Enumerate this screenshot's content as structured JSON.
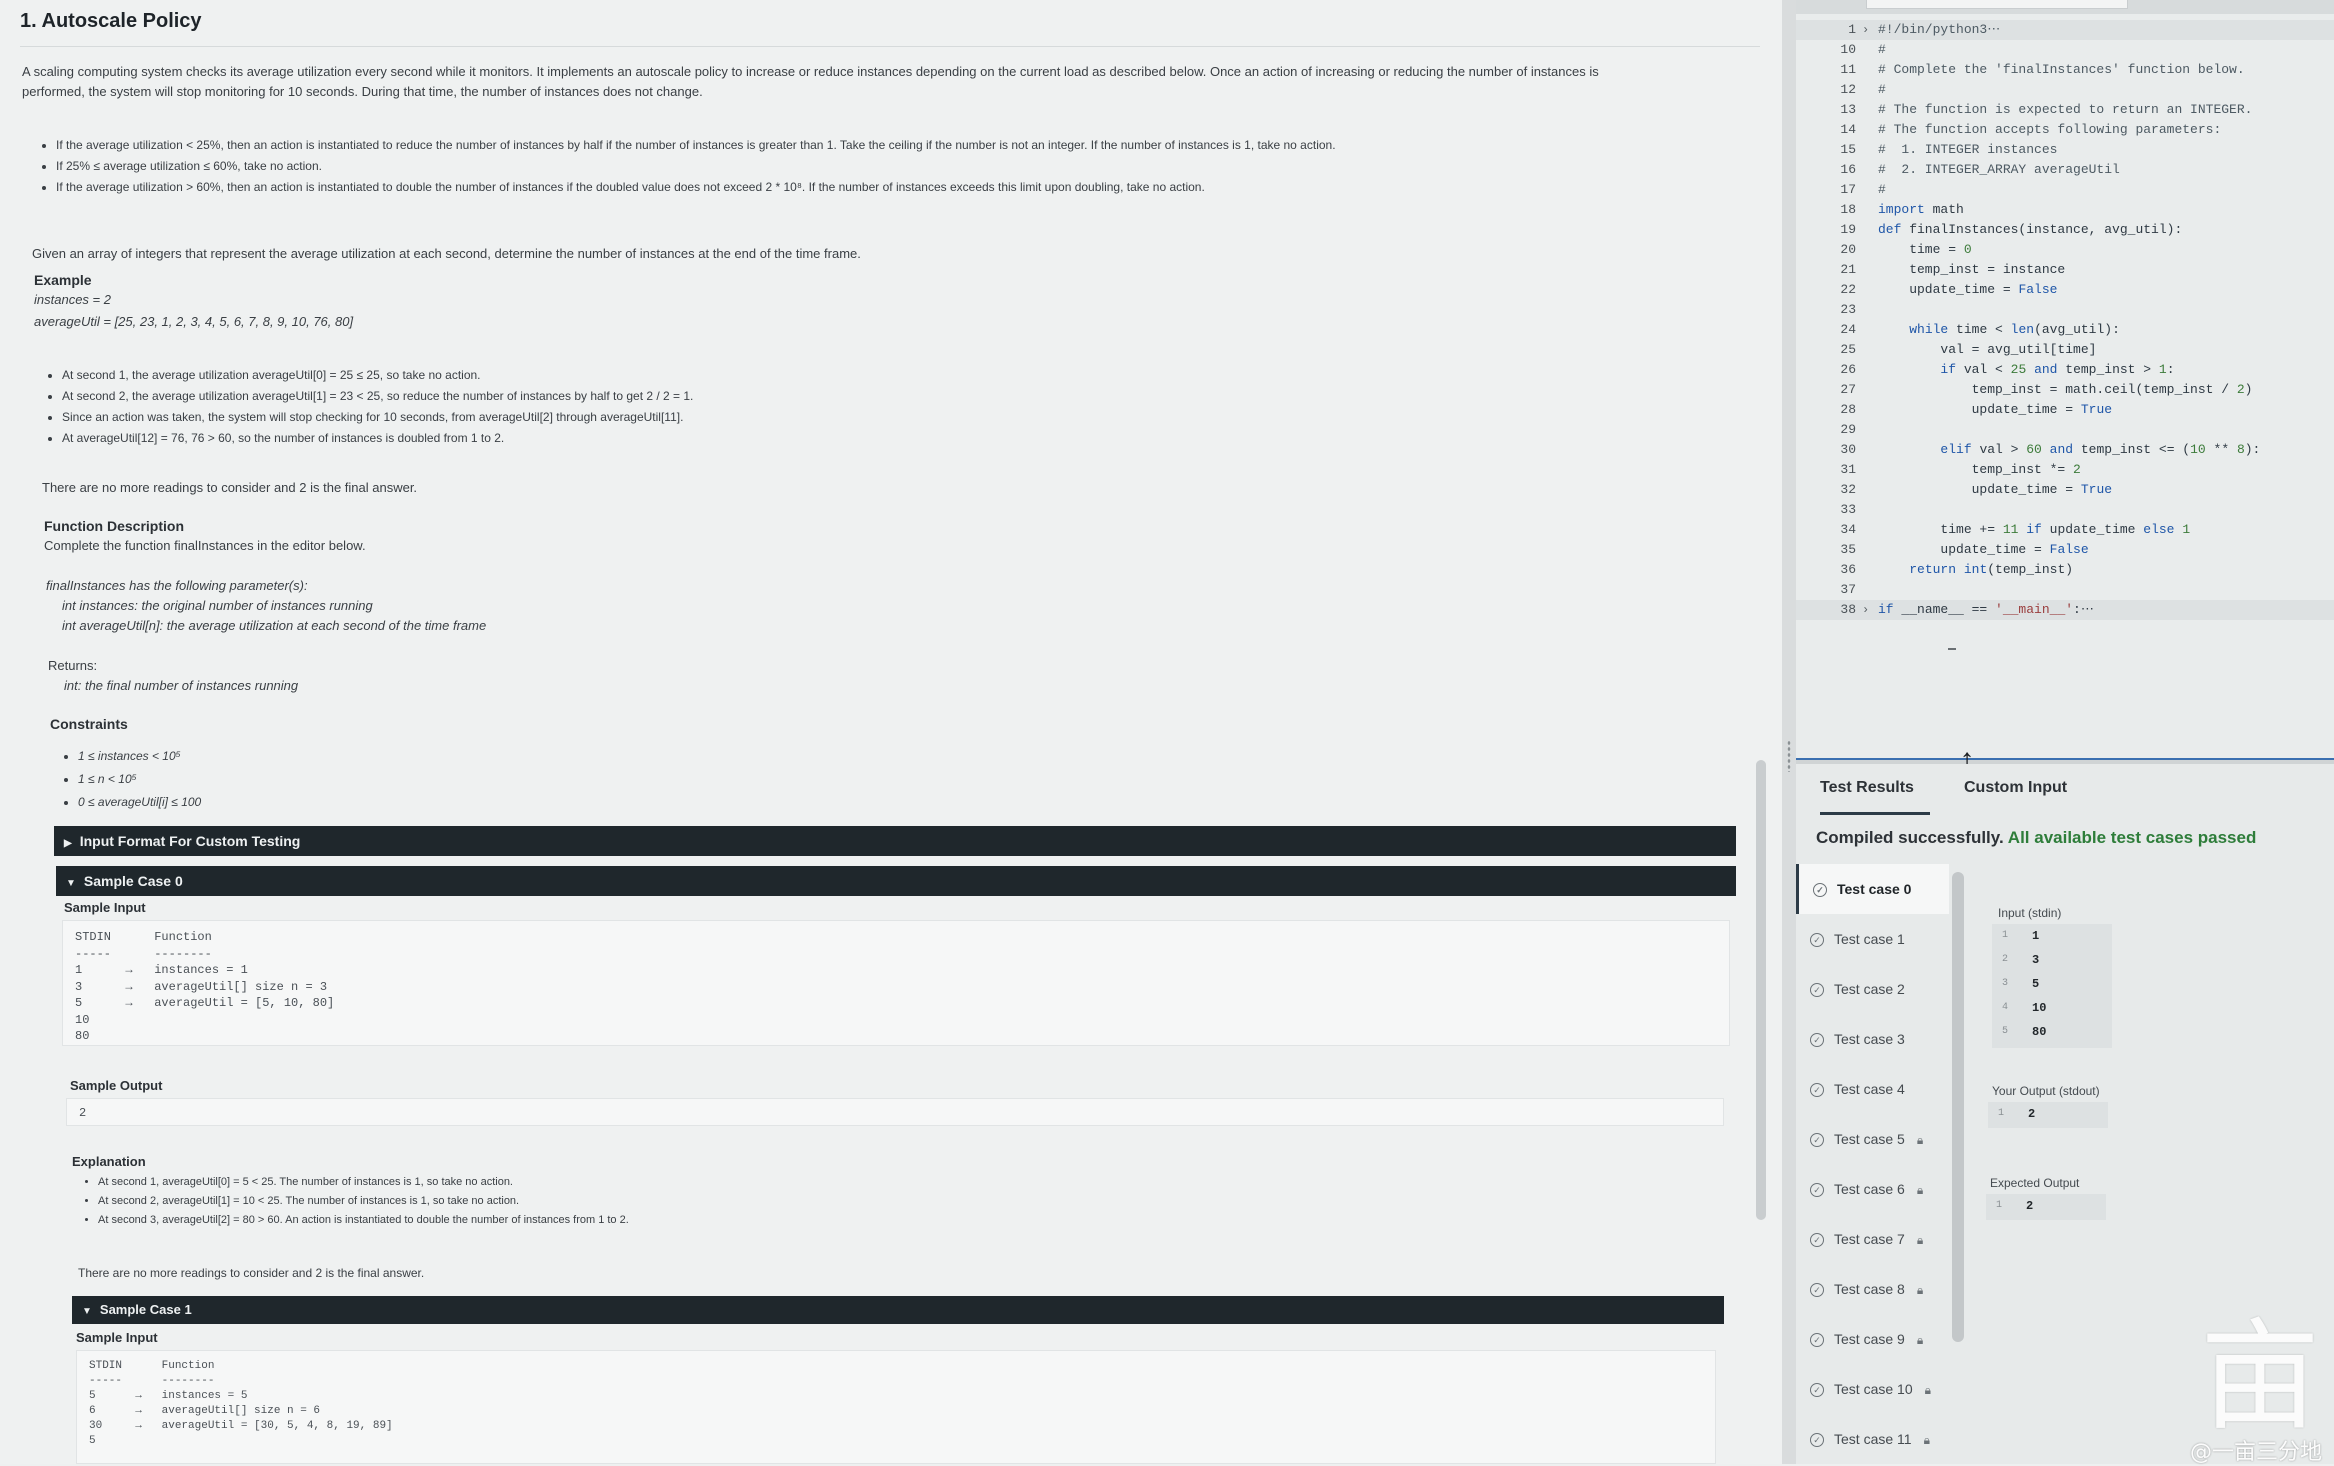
{
  "problem": {
    "title": "1. Autoscale Policy",
    "intro": [
      "A scaling computing system checks its average utilization every second while it monitors. It implements an autoscale policy to increase or reduce instances depending on the current load as described below. Once an action of increasing or reducing the number of instances is",
      "performed, the system will stop monitoring for 10 seconds. During that time, the number of instances does not change."
    ],
    "rules": [
      "If the average utilization < 25%, then an action is instantiated to reduce the number of instances by half if the number of instances is greater than 1. Take the ceiling if the number is not an integer. If the number of instances is 1, take no action.",
      "If 25% ≤ average utilization ≤ 60%, take no action.",
      "If the average utilization > 60%, then an action is instantiated to double the number of instances if the doubled value does not exceed 2 * 10⁸. If the number of instances exceeds this limit upon doubling, take no action."
    ],
    "task": "Given an array of integers that represent the average utilization at each second, determine the number of instances at the end of the time frame.",
    "example_heading": "Example",
    "example_lines": [
      "instances = 2",
      "averageUtil = [25, 23, 1, 2, 3, 4, 5, 6, 7, 8, 9, 10, 76, 80]"
    ],
    "example_bullets": [
      "At second 1, the average utilization averageUtil[0] = 25 ≤ 25, so take no action.",
      "At second 2, the average utilization averageUtil[1] = 23 < 25, so reduce the number of instances by half to get 2 / 2 = 1.",
      "Since an action was taken, the system will stop checking for 10 seconds, from averageUtil[2] through averageUtil[11].",
      "At averageUtil[12] = 76, 76 > 60, so the number of instances is doubled from 1 to 2."
    ],
    "final_note": "There are no more readings to consider and 2 is the final answer.",
    "fd_heading": "Function Description",
    "fd_text": "Complete the function finalInstances in the editor below.",
    "params_intro": "finalInstances has the following parameter(s):",
    "params": [
      "int instances: the original number of instances running",
      "int averageUtil[n]: the average utilization at each second of the time frame"
    ],
    "returns_label": "Returns:",
    "returns_text": "int: the final number of instances running",
    "constraints_heading": "Constraints",
    "constraints": [
      "1 ≤ instances < 10⁵",
      "1 ≤ n < 10⁵",
      "0 ≤ averageUtil[i] ≤ 100"
    ],
    "input_format_bar": "Input Format For Custom Testing",
    "sample0": {
      "bar": "Sample Case 0",
      "input_heading": "Sample Input",
      "stdin_block": "STDIN      Function\n-----      --------\n1      →   instances = 1\n3      →   averageUtil[] size n = 3\n5      →   averageUtil = [5, 10, 80]\n10\n80",
      "output_heading": "Sample Output",
      "output_value": "2",
      "explanation_heading": "Explanation",
      "explanation": [
        "At second 1, averageUtil[0] = 5 < 25. The number of instances is 1, so take no action.",
        "At second 2, averageUtil[1] = 10 < 25. The number of instances is 1, so take no action.",
        "At second 3, averageUtil[2] = 80 > 60. An action is instantiated to double the number of instances from 1 to 2."
      ],
      "final_note": "There are no more readings to consider and 2 is the final answer."
    },
    "sample1": {
      "bar": "Sample Case 1",
      "input_heading": "Sample Input",
      "stdin_block": "STDIN      Function\n-----      --------\n5      →   instances = 5\n6      →   averageUtil[] size n = 6\n30     →   averageUtil = [30, 5, 4, 8, 19, 89]\n5"
    }
  },
  "editor": {
    "lines": [
      {
        "n": "1",
        "fold": true,
        "code": "#!/bin/python3⋯"
      },
      {
        "n": "10",
        "code": "#"
      },
      {
        "n": "11",
        "code": "# Complete the 'finalInstances' function below."
      },
      {
        "n": "12",
        "code": "#"
      },
      {
        "n": "13",
        "code": "# The function is expected to return an INTEGER."
      },
      {
        "n": "14",
        "code": "# The function accepts following parameters:"
      },
      {
        "n": "15",
        "code": "#  1. INTEGER instances"
      },
      {
        "n": "16",
        "code": "#  2. INTEGER_ARRAY averageUtil"
      },
      {
        "n": "17",
        "code": "#"
      },
      {
        "n": "18",
        "code": "import math"
      },
      {
        "n": "19",
        "code": "def finalInstances(instance, avg_util):"
      },
      {
        "n": "20",
        "code": "    time = 0"
      },
      {
        "n": "21",
        "code": "    temp_inst = instance"
      },
      {
        "n": "22",
        "code": "    update_time = False"
      },
      {
        "n": "23",
        "code": ""
      },
      {
        "n": "24",
        "code": "    while time < len(avg_util):"
      },
      {
        "n": "25",
        "code": "        val = avg_util[time]"
      },
      {
        "n": "26",
        "code": "        if val < 25 and temp_inst > 1:"
      },
      {
        "n": "27",
        "code": "            temp_inst = math.ceil(temp_inst / 2)"
      },
      {
        "n": "28",
        "code": "            update_time = True"
      },
      {
        "n": "29",
        "code": ""
      },
      {
        "n": "30",
        "code": "        elif val > 60 and temp_inst <= (10 ** 8):"
      },
      {
        "n": "31",
        "code": "            temp_inst *= 2"
      },
      {
        "n": "32",
        "code": "            update_time = True"
      },
      {
        "n": "33",
        "code": ""
      },
      {
        "n": "34",
        "code": "        time += 11 if update_time else 1"
      },
      {
        "n": "35",
        "code": "        update_time = False"
      },
      {
        "n": "36",
        "code": "    return int(temp_inst)"
      },
      {
        "n": "37",
        "code": ""
      },
      {
        "n": "38",
        "fold": true,
        "code": "if __name__ == '__main__':⋯"
      }
    ]
  },
  "results": {
    "tabs": [
      "Test Results",
      "Custom Input"
    ],
    "summary_compiled": "Compiled successfully.",
    "summary_passed": "All available test cases passed",
    "test_cases": [
      {
        "label": "Test case 0",
        "locked": false
      },
      {
        "label": "Test case 1",
        "locked": false
      },
      {
        "label": "Test case 2",
        "locked": false
      },
      {
        "label": "Test case 3",
        "locked": false
      },
      {
        "label": "Test case 4",
        "locked": false
      },
      {
        "label": "Test case 5",
        "locked": true
      },
      {
        "label": "Test case 6",
        "locked": true
      },
      {
        "label": "Test case 7",
        "locked": true
      },
      {
        "label": "Test case 8",
        "locked": true
      },
      {
        "label": "Test case 9",
        "locked": true
      },
      {
        "label": "Test case 10",
        "locked": true
      },
      {
        "label": "Test case 11",
        "locked": true
      }
    ],
    "input_label": "Input (stdin)",
    "input_values": [
      "1",
      "3",
      "5",
      "10",
      "80"
    ],
    "output_label": "Your Output (stdout)",
    "output_values": [
      "2"
    ],
    "expected_label": "Expected Output",
    "expected_values": [
      "2"
    ]
  },
  "watermark": {
    "glyph": "亩",
    "text": "@一亩三分地"
  },
  "colors": {
    "section_bar": "#1f272c",
    "success_green": "#2e7d3a",
    "keyword_blue": "#1f56a8"
  }
}
